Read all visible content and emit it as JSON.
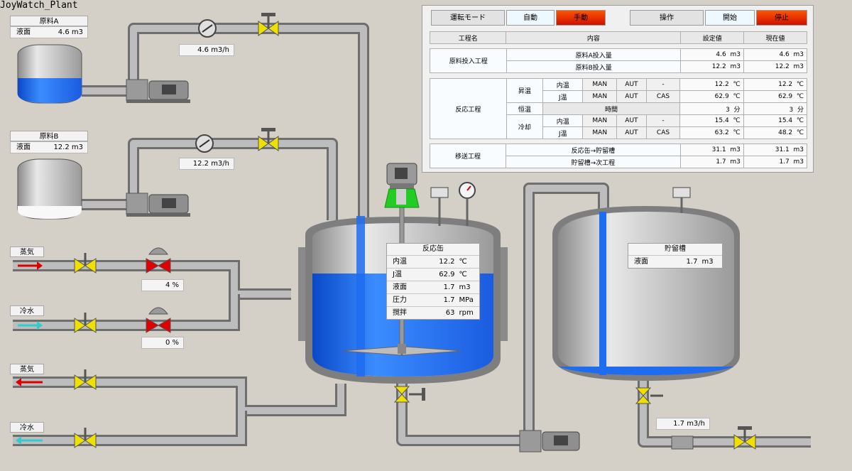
{
  "app": {
    "title": "JoyWatch_Plant"
  },
  "tank_a": {
    "name": "原料A",
    "level_label": "液面",
    "level_value": "4.6",
    "unit": "m3"
  },
  "tank_b": {
    "name": "原料B",
    "level_label": "液面",
    "level_value": "12.2",
    "unit": "m3"
  },
  "flow_a": {
    "value": "4.6",
    "unit": "m3/h"
  },
  "flow_b": {
    "value": "12.2",
    "unit": "m3/h"
  },
  "inlets": [
    {
      "label": "蒸気",
      "arrow_color": "#dd0000",
      "direction": "right"
    },
    {
      "label": "冷水",
      "arrow_color": "#33cccc",
      "direction": "right"
    },
    {
      "label": "蒸気",
      "arrow_color": "#dd0000",
      "direction": "left"
    },
    {
      "label": "冷水",
      "arrow_color": "#33cccc",
      "direction": "left"
    }
  ],
  "valve_open": {
    "steam": "4 %",
    "water": "0 %"
  },
  "reactor": {
    "title": "反応缶",
    "rows": [
      {
        "label": "内温",
        "value": "12.2",
        "unit": "℃"
      },
      {
        "label": "J温",
        "value": "62.9",
        "unit": "℃"
      },
      {
        "label": "液面",
        "value": "1.7",
        "unit": "m3"
      },
      {
        "label": "圧力",
        "value": "1.7",
        "unit": "MPa"
      },
      {
        "label": "撹拌",
        "value": "63",
        "unit": "rpm"
      }
    ],
    "level_fraction": 0.6
  },
  "storage": {
    "title": "貯留槽",
    "level_label": "液面",
    "level_value": "1.7",
    "unit": "m3",
    "level_fraction": 0.05
  },
  "flow_out": {
    "value": "1.7",
    "unit": "m3/h"
  },
  "panel": {
    "mode_label": "運転モード",
    "auto_label": "自動",
    "manual_label": "手動",
    "op_label": "操作",
    "start_label": "開始",
    "stop_label": "停止",
    "col_process": "工程名",
    "col_content": "内容",
    "col_set": "設定値",
    "col_current": "現在値",
    "feed": {
      "name": "原料投入工程",
      "rows": [
        {
          "content": "原料A投入量",
          "set": "4.6",
          "set_unit": "m3",
          "cur": "4.6",
          "cur_unit": "m3"
        },
        {
          "content": "原料B投入量",
          "set": "12.2",
          "set_unit": "m3",
          "cur": "12.2",
          "cur_unit": "m3"
        }
      ]
    },
    "react": {
      "name": "反応工程",
      "heat": "昇温",
      "hold": "恒温",
      "cool": "冷却",
      "time_label": "時間",
      "rows": [
        {
          "sub": "内温",
          "man": "MAN",
          "aut": "AUT",
          "cas": "-",
          "set": "12.2",
          "set_unit": "℃",
          "cur": "12.2",
          "cur_unit": "℃"
        },
        {
          "sub": "J温",
          "man": "MAN",
          "aut": "AUT",
          "cas": "CAS",
          "set": "62.9",
          "set_unit": "℃",
          "cur": "62.9",
          "cur_unit": "℃"
        },
        {
          "set": "3",
          "set_unit": "分",
          "cur": "3",
          "cur_unit": "分"
        },
        {
          "sub": "内温",
          "man": "MAN",
          "aut": "AUT",
          "cas": "-",
          "set": "15.4",
          "set_unit": "℃",
          "cur": "15.4",
          "cur_unit": "℃"
        },
        {
          "sub": "J温",
          "man": "MAN",
          "aut": "AUT",
          "cas": "CAS",
          "set": "63.2",
          "set_unit": "℃",
          "cur": "48.2",
          "cur_unit": "℃"
        }
      ]
    },
    "transfer": {
      "name": "移送工程",
      "rows": [
        {
          "content": "反応缶→貯留槽",
          "set": "31.1",
          "set_unit": "m3",
          "cur": "31.1",
          "cur_unit": "m3"
        },
        {
          "content": "貯留槽→次工程",
          "set": "1.7",
          "set_unit": "m3",
          "cur": "1.7",
          "cur_unit": "m3"
        }
      ]
    }
  },
  "colors": {
    "liquid": "#1e6cf0",
    "pipe": "#a9a9a9",
    "valve_yellow": "#f0e000",
    "valve_red": "#e00000",
    "motor_green": "#22cc22"
  }
}
